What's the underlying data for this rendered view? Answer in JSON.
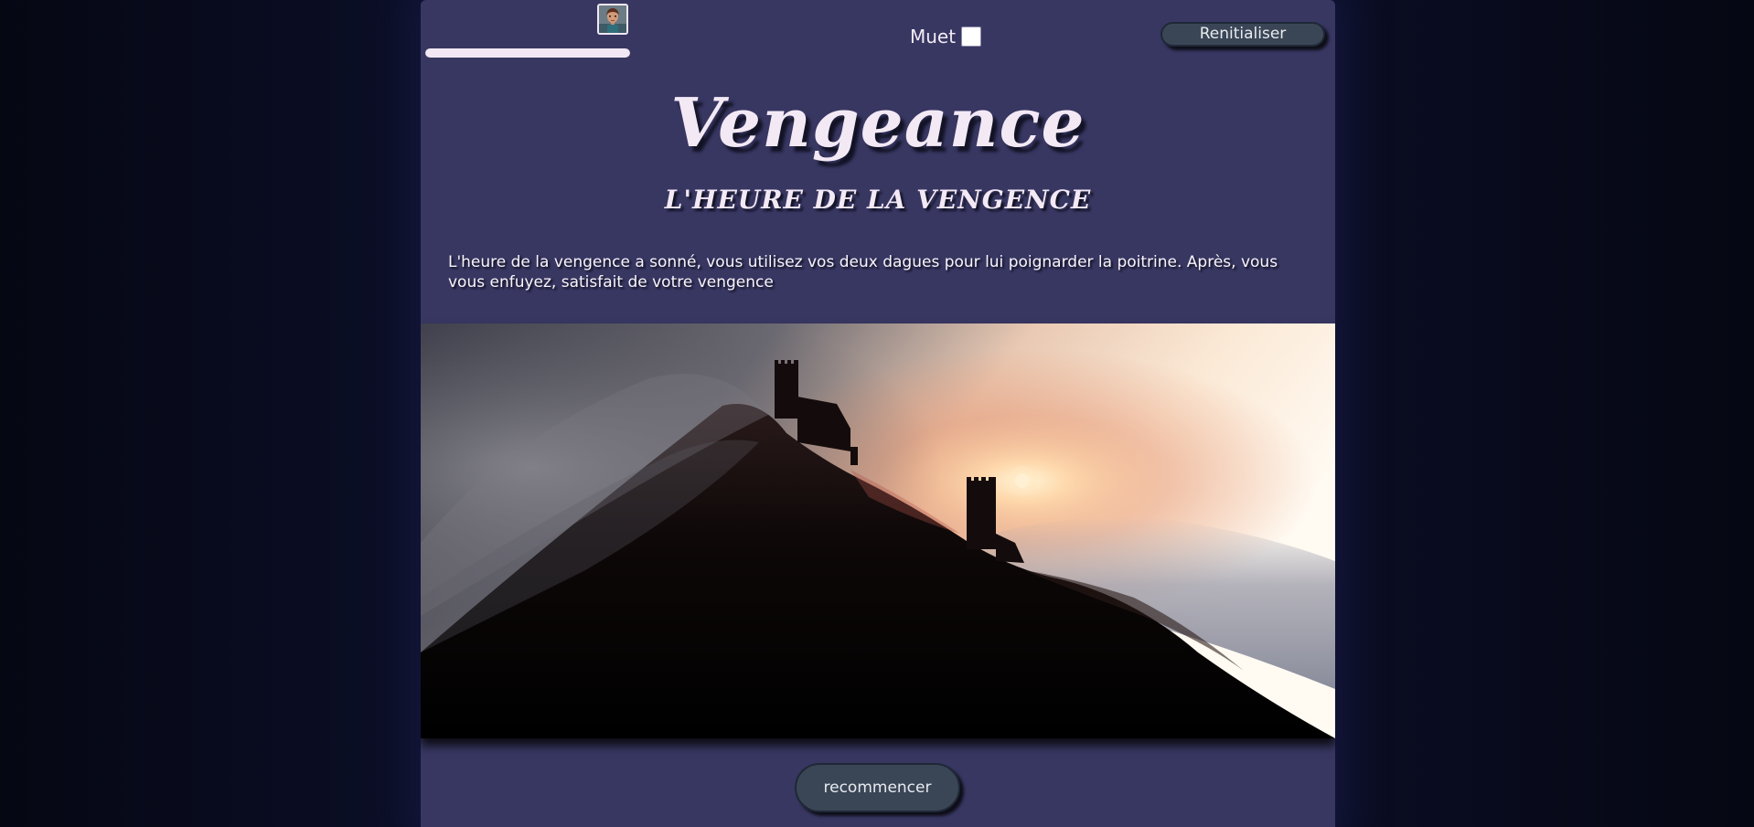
{
  "header": {
    "avatar_icon": "character-portrait-icon",
    "health_progress": 1.0,
    "mute_label": "Muet",
    "mute_checked": false,
    "reset_label": "Renitialiser"
  },
  "story": {
    "title": "Vengeance",
    "subtitle": "L'HEURE DE LA VENGENCE",
    "text": "L'heure de la vengence a sonné, vous utilisez vos deux dagues pour lui poignarder la poitrine. Après, vous vous enfuyez, satisfait de votre vengence",
    "scene_image": "castle-in-fog-at-sunrise"
  },
  "actions": {
    "restart_label": "recommencer"
  },
  "colors": {
    "page_background": "#070a18",
    "panel_background": "#383762",
    "text_light": "#f3e9f5",
    "button_background": "#3a4656"
  }
}
